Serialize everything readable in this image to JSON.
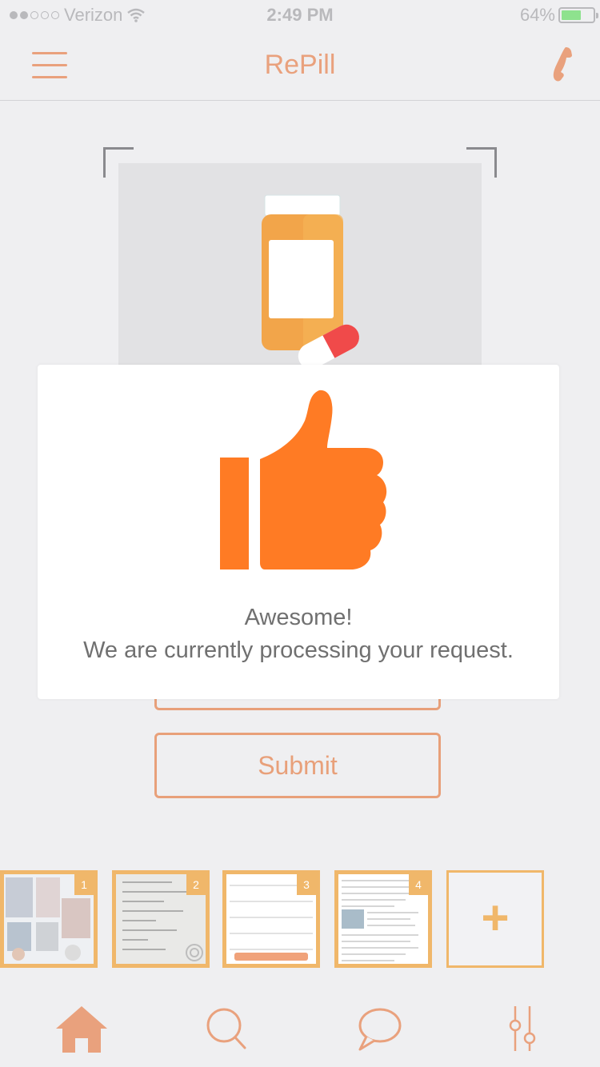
{
  "status_bar": {
    "carrier": "Verizon",
    "time": "2:49 PM",
    "battery": "64%",
    "battery_level": 0.64
  },
  "nav": {
    "title": "RePill"
  },
  "buttons": {
    "submit_label": "Submit"
  },
  "modal": {
    "title": "Awesome!",
    "message": "We are currently processing your request."
  },
  "thumbnails": [
    {
      "number": "1"
    },
    {
      "number": "2"
    },
    {
      "number": "3"
    },
    {
      "number": "4"
    }
  ],
  "add_thumbnail": {
    "label": "+"
  },
  "colors": {
    "accent": "#e9a17d",
    "thumb_up": "#ff7b24",
    "thumb_border": "#f0b76a"
  },
  "tabs": [
    {
      "icon": "home-icon"
    },
    {
      "icon": "search-icon"
    },
    {
      "icon": "chat-icon"
    },
    {
      "icon": "sliders-icon"
    }
  ]
}
